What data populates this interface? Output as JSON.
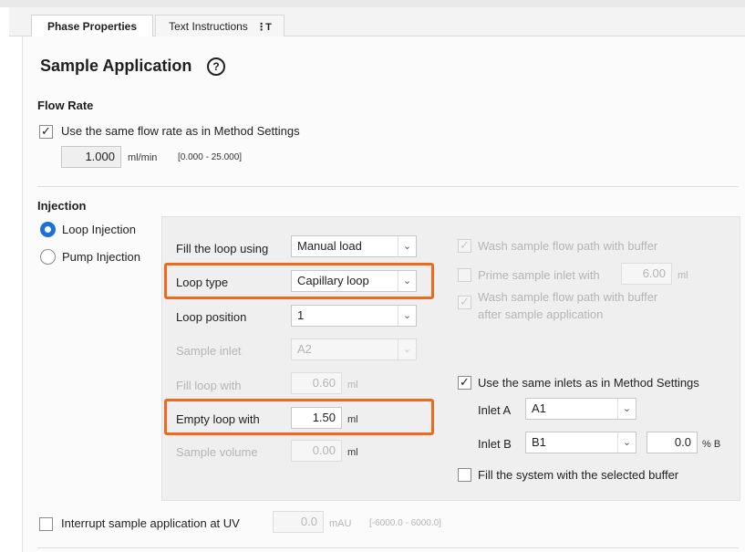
{
  "tabs": [
    {
      "label": "Phase Properties"
    },
    {
      "label": "Text Instructions",
      "icon": "text-format-icon",
      "icon_glyph": "⋮T"
    }
  ],
  "title": "Sample Application",
  "help_icon": {
    "icon": "help-icon",
    "glyph": "?"
  },
  "flow_rate": {
    "heading": "Flow Rate",
    "same_as_method_label": "Use the same flow rate as in Method Settings",
    "same_as_method_checked": true,
    "value": "1.000",
    "unit": "ml/min",
    "range": "[0.000 - 25.000]"
  },
  "injection": {
    "heading": "Injection",
    "modes": [
      {
        "label": "Loop Injection",
        "selected": true
      },
      {
        "label": "Pump Injection",
        "selected": false
      }
    ],
    "fill_loop_using": {
      "label": "Fill the loop using",
      "value": "Manual load"
    },
    "loop_type": {
      "label": "Loop type",
      "value": "Capillary loop"
    },
    "loop_position": {
      "label": "Loop position",
      "value": "1"
    },
    "sample_inlet": {
      "label": "Sample inlet",
      "value": "A2"
    },
    "fill_loop_with": {
      "label": "Fill loop with",
      "value": "0.60",
      "unit": "ml"
    },
    "empty_loop_with": {
      "label": "Empty loop with",
      "value": "1.50",
      "unit": "ml"
    },
    "sample_volume": {
      "label": "Sample volume",
      "value": "0.00",
      "unit": "ml"
    },
    "wash_flow_path": {
      "label": "Wash sample flow path with buffer",
      "checked": true
    },
    "prime_sample_inlet": {
      "label": "Prime sample inlet with",
      "value": "6.00",
      "unit": "ml",
      "checked": false
    },
    "wash_after": {
      "label_line1": "Wash sample flow path with buffer",
      "label_line2": "after sample application",
      "checked": true
    },
    "same_inlets": {
      "label": "Use the same inlets as in Method Settings",
      "checked": true
    },
    "inlet_a": {
      "label": "Inlet A",
      "value": "A1"
    },
    "inlet_b": {
      "label": "Inlet B",
      "value": "B1",
      "percent_value": "0.0",
      "percent_unit": "% B"
    },
    "fill_system": {
      "label": "Fill the system with the selected buffer",
      "checked": false
    }
  },
  "interrupt": {
    "label": "Interrupt sample application at UV",
    "checked": false,
    "value": "0.0",
    "unit": "mAU",
    "range": "[-6000.0 - 6000.0]"
  },
  "glyphs": {
    "check": "✓",
    "chevron": "⌄"
  },
  "colors": {
    "highlight": "#ee6a1a",
    "radio_selected": "#1e6fd9"
  }
}
